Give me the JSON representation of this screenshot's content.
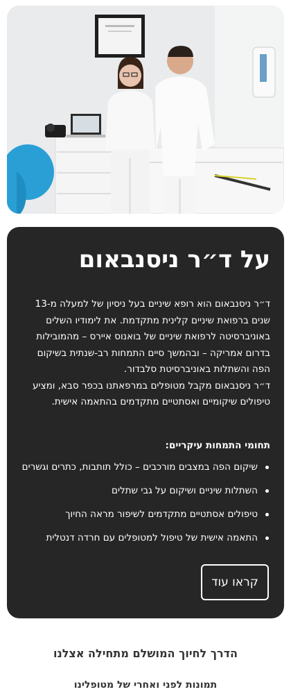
{
  "photo": {
    "description_icon": "dentist-team-photo"
  },
  "about": {
    "title": "על ד״ר ניסנבאום",
    "bio_paragraphs": [
      "ד״ר ניסנבאום הוא רופא שיניים בעל ניסיון של למעלה מ-13 שנים ברפואת שיניים קלינית מתקדמת. את לימודיו השלים באוניברסיטה לרפואת שיניים של בואנוס איירס – מהמובילות בדרום אמריקה – ובהמשך סיים התמחות רב-שנתית בשיקום הפה והשתלות באוניברסיטת סלבדור.",
      "ד״ר ניסנבאום מקבל מטופלים במרפאתנו בכפר סבא, ומציע טיפולים שיקומיים ואסתטיים מתקדמים בהתאמה אישית."
    ],
    "areas_title": "תחומי התמחות עיקריים:",
    "areas": [
      "שיקום הפה במצבים מורכבים – כולל תותבות, כתרים וגשרים",
      "השתלות שיניים ושיקום על גבי שתלים",
      "טיפולים אסתטיים מתקדמים לשיפור מראה החיוך",
      "התאמה אישית של טיפול למטופלים עם חרדה דנטלית"
    ],
    "more_label": "קראו עוד"
  },
  "journey": {
    "title": "הדרך לחיוך המושלם מתחילה אצלנו",
    "subtitle": "תמונות לפני ואחרי של מטופלינו"
  }
}
